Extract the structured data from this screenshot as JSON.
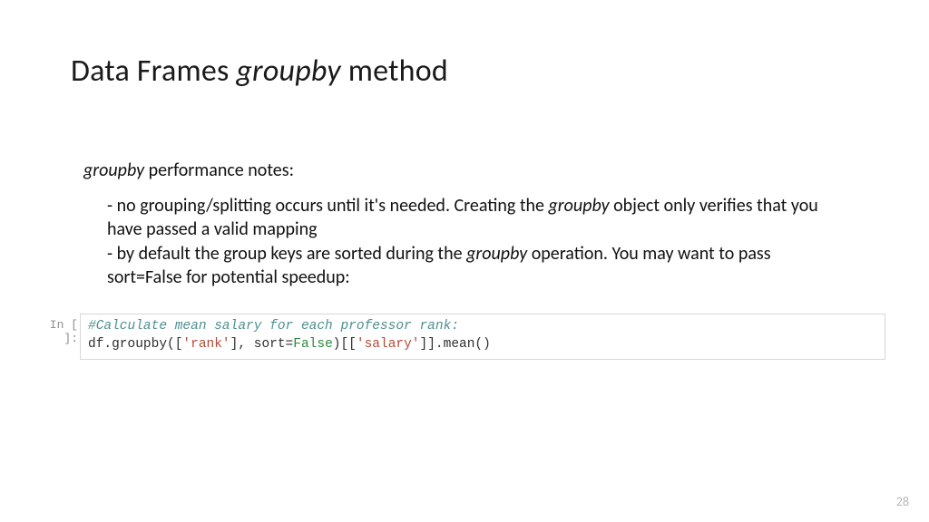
{
  "title": {
    "pre": "Data Frames ",
    "em": "groupby",
    "post": " method"
  },
  "notes_heading": {
    "em": "groupby",
    "post": " performance notes:"
  },
  "notes": {
    "b1_pre": "- no grouping/splitting occurs until it's needed. Creating the ",
    "b1_em": "groupby",
    "b1_post": " object only verifies that you have passed a valid mapping",
    "b2_pre": "- by default the group keys are sorted during the ",
    "b2_em": "groupby",
    "b2_post": " operation. You may want to pass sort=False for potential speedup:"
  },
  "code": {
    "in_label": "In [ ]:",
    "comment": "#Calculate mean salary for each professor rank:",
    "l2_a": "df.groupby([",
    "l2_rank": "'rank'",
    "l2_b": "], sort=",
    "l2_false": "False",
    "l2_c": ")[[",
    "l2_salary": "'salary'",
    "l2_d": "]].mean()"
  },
  "page_number": "28"
}
